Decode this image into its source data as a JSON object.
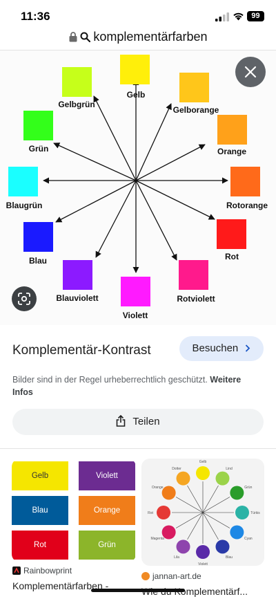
{
  "status": {
    "time": "11:36",
    "battery": "99"
  },
  "url": "komplementärfarben",
  "wheel": {
    "labels": {
      "gelb": "Gelb",
      "gelborange": "Gelborange",
      "orange": "Orange",
      "rotorange": "Rotorange",
      "rot": "Rot",
      "rotviolett": "Rotviolett",
      "violett": "Violett",
      "blauviolett": "Blauviolett",
      "blau": "Blau",
      "blaugruen": "Blaugrün",
      "gruen": "Grün",
      "gelbgruen": "Gelbgrün"
    },
    "colors": {
      "gelb": "#ffef0a",
      "gelborange": "#ffc61a",
      "orange": "#ffa11a",
      "rotorange": "#ff6a1a",
      "rot": "#ff1a1a",
      "rotviolett": "#ff1a8c",
      "violett": "#ff1aff",
      "blauviolett": "#8c1aff",
      "blau": "#1a1aff",
      "blaugruen": "#1affff",
      "gruen": "#33ff1a",
      "gelbgruen": "#c6ff1a"
    }
  },
  "result": {
    "title": "Komplementär-Kontrast",
    "visit_label": "Besuchen",
    "copyright_text": "Bilder sind in der Regel urheberrechtlich geschützt.",
    "copyright_link": "Weitere Infos",
    "share_label": "Teilen"
  },
  "related": [
    {
      "source": "Rainbowprint",
      "caption": "Komplementärfarben -",
      "tiles": [
        {
          "label": "Gelb",
          "bg": "#f5e600",
          "fg": "#333333"
        },
        {
          "label": "Violett",
          "bg": "#6c2c91",
          "fg": "#ffffff"
        },
        {
          "label": "Blau",
          "bg": "#005b9a",
          "fg": "#ffffff"
        },
        {
          "label": "Orange",
          "bg": "#f07d1a",
          "fg": "#ffffff"
        },
        {
          "label": "Rot",
          "bg": "#e1001a",
          "fg": "#ffffff"
        },
        {
          "label": "Grün",
          "bg": "#8cb52a",
          "fg": "#ffffff"
        }
      ]
    },
    {
      "source": "jannan-art.de",
      "caption": "Wie du Komplementärf...",
      "wheel_labels": [
        "Gelb",
        "Lind",
        "Grün",
        "Türkis",
        "Cyan",
        "Blau",
        "Violett",
        "Lila",
        "Magenta",
        "Rot",
        "Orange",
        "Dotter"
      ]
    }
  ]
}
